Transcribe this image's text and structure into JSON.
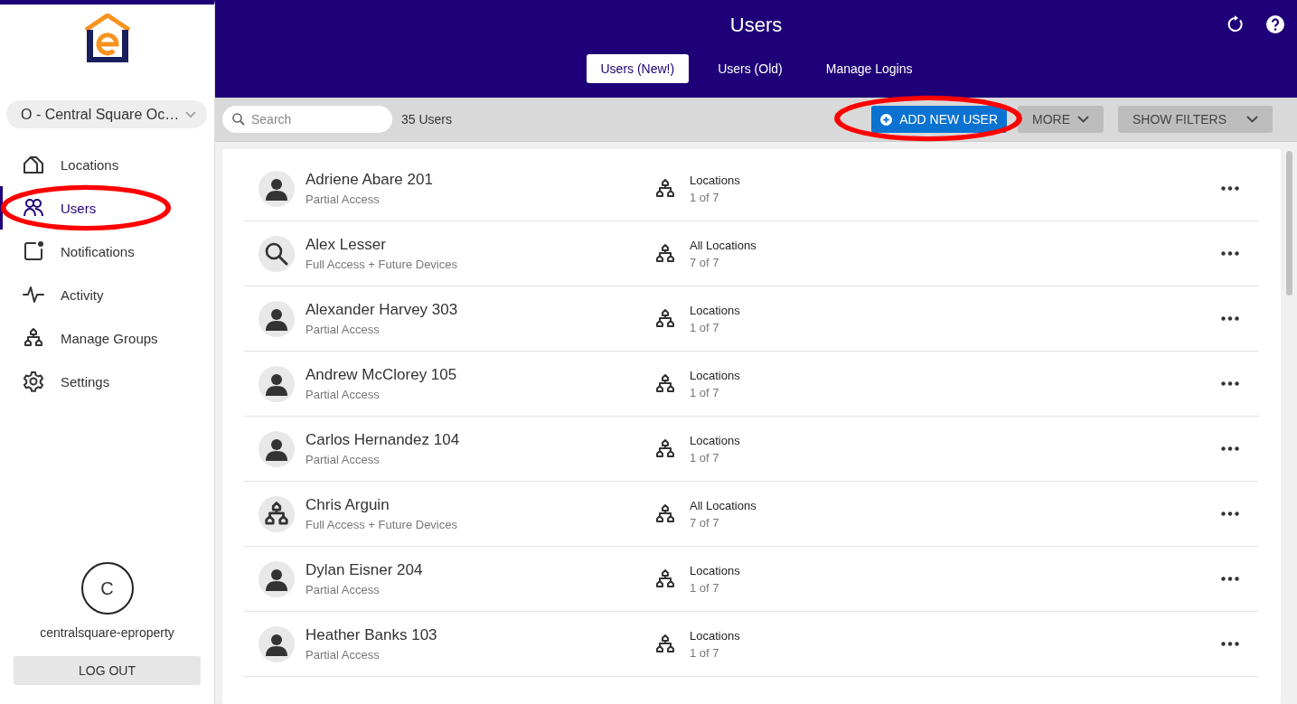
{
  "site_selector": {
    "value": "O - Central Square Oc…"
  },
  "sidebar": {
    "items": [
      {
        "label": "Locations",
        "kind": "house",
        "selected": false,
        "circled": false
      },
      {
        "label": "Users",
        "kind": "users",
        "selected": true,
        "circled": true
      },
      {
        "label": "Notifications",
        "kind": "notification",
        "selected": false,
        "circled": false
      },
      {
        "label": "Activity",
        "kind": "activity",
        "selected": false,
        "circled": false
      },
      {
        "label": "Manage Groups",
        "kind": "groups",
        "selected": false,
        "circled": false
      },
      {
        "label": "Settings",
        "kind": "settings",
        "selected": false,
        "circled": false
      }
    ]
  },
  "account": {
    "initial": "C",
    "name": "centralsquare-eproperty"
  },
  "logout_button": "LOG OUT",
  "header": {
    "title": "Users",
    "tabs": [
      {
        "label": "Users (New!)",
        "selected": true
      },
      {
        "label": "Users (Old)",
        "selected": false
      },
      {
        "label": "Manage Logins",
        "selected": false
      }
    ]
  },
  "toolbar": {
    "search": {
      "placeholder": "Search"
    },
    "count": "35 Users",
    "add_button": {
      "label": "ADD NEW USER",
      "circled": true
    },
    "more_button": "MORE",
    "filters_button": "SHOW FILTERS"
  },
  "users": [
    {
      "name": "Adriene Abare 201",
      "access": "Partial Access",
      "kind": "person",
      "scope": "Locations",
      "count": "1 of 7"
    },
    {
      "name": "Alex Lesser",
      "access": "Full Access + Future Devices",
      "kind": "search",
      "scope": "All Locations",
      "count": "7 of 7"
    },
    {
      "name": "Alexander Harvey 303",
      "access": "Partial Access",
      "kind": "person",
      "scope": "Locations",
      "count": "1 of 7"
    },
    {
      "name": "Andrew McClorey 105",
      "access": "Partial Access",
      "kind": "person",
      "scope": "Locations",
      "count": "1 of 7"
    },
    {
      "name": "Carlos Hernandez 104",
      "access": "Partial Access",
      "kind": "person",
      "scope": "Locations",
      "count": "1 of 7"
    },
    {
      "name": "Chris Arguin",
      "access": "Full Access + Future Devices",
      "kind": "groups",
      "scope": "All Locations",
      "count": "7 of 7"
    },
    {
      "name": "Dylan Eisner 204",
      "access": "Partial Access",
      "kind": "person",
      "scope": "Locations",
      "count": "1 of 7"
    },
    {
      "name": "Heather Banks 103",
      "access": "Partial Access",
      "kind": "person",
      "scope": "Locations",
      "count": "1 of 7"
    }
  ]
}
